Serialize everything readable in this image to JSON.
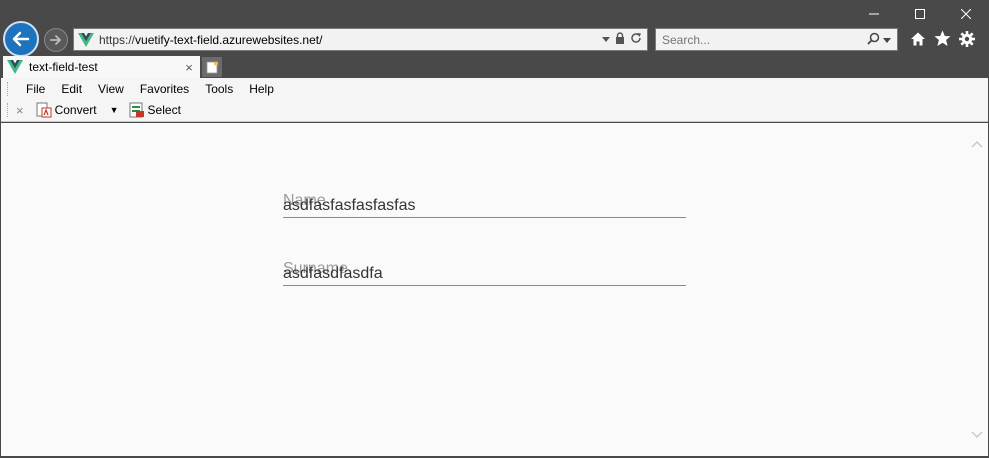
{
  "browser": {
    "url_protocol": "https://",
    "url_host": "vuetify-text-field.azurewebsites.net/",
    "search_placeholder": "Search...",
    "tab_title": "text-field-test",
    "tab_close": "×"
  },
  "menu": {
    "file": "File",
    "edit": "Edit",
    "view": "View",
    "favorites": "Favorites",
    "tools": "Tools",
    "help": "Help"
  },
  "commands": {
    "close": "×",
    "convert": "Convert",
    "select": "Select"
  },
  "form": {
    "name_label": "Name",
    "name_value": "asdfasfasfasfasfas",
    "surname_label": "Surname",
    "surname_value": "asdfasdfasdfa"
  },
  "icons": {
    "back": "arrow-left-icon",
    "forward": "arrow-right-icon",
    "site": "vue-logo-icon",
    "lock": "lock-icon",
    "refresh": "refresh-icon",
    "search": "search-icon",
    "home": "home-icon",
    "favorites": "star-icon",
    "settings": "gear-icon"
  },
  "colors": {
    "chrome": "#494949",
    "back_button": "#1e73be",
    "vue_green": "#41b883",
    "vue_dark": "#35495e"
  }
}
